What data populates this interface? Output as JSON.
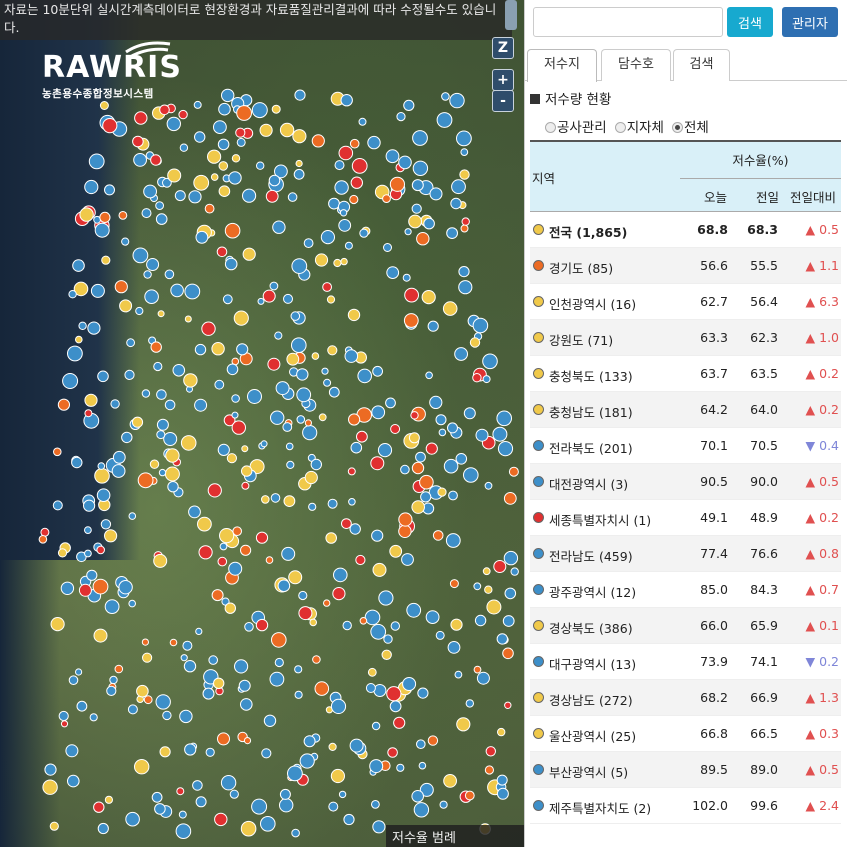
{
  "notice": "자료는 10분단위 실시간계측데이터로 현장환경과 자료품질관리결과에 따라 수정될수도 있습니다.",
  "logo": {
    "brand": "RAWRIS",
    "subtitle": "농촌용수종합정보시스템"
  },
  "map_controls": {
    "z_label": "Z",
    "zoom_in": "+",
    "zoom_out": "-"
  },
  "legend_label": "저수율 범례",
  "search": {
    "placeholder": "",
    "button": "검색",
    "admin": "관리자"
  },
  "tabs": [
    "저수지",
    "담수호",
    "검색"
  ],
  "section_title": "저수량 현황",
  "filters": [
    {
      "label": "공사관리",
      "checked": false
    },
    {
      "label": "지자체",
      "checked": false
    },
    {
      "label": "전체",
      "checked": true
    }
  ],
  "table": {
    "headers": {
      "region": "지역",
      "rate": "저수율(%)",
      "today": "오늘",
      "yesterday": "전일",
      "diff": "전일대비"
    },
    "rows": [
      {
        "name": "전국 (1,865)",
        "today": "68.8",
        "yesterday": "68.3",
        "diff": "▲ 0.5",
        "dot": "#f0c94a",
        "diff_color": "#e05050",
        "bold": true
      },
      {
        "name": "경기도 (85)",
        "today": "56.6",
        "yesterday": "55.5",
        "diff": "▲ 1.1",
        "dot": "#ec6b23",
        "diff_color": "#e05050"
      },
      {
        "name": "인천광역시 (16)",
        "today": "62.7",
        "yesterday": "56.4",
        "diff": "▲ 6.3",
        "dot": "#f0c94a",
        "diff_color": "#e05050"
      },
      {
        "name": "강원도 (71)",
        "today": "63.3",
        "yesterday": "62.3",
        "diff": "▲ 1.0",
        "dot": "#f0c94a",
        "diff_color": "#e05050"
      },
      {
        "name": "충청북도 (133)",
        "today": "63.7",
        "yesterday": "63.5",
        "diff": "▲ 0.2",
        "dot": "#f0c94a",
        "diff_color": "#e05050"
      },
      {
        "name": "충청남도 (181)",
        "today": "64.2",
        "yesterday": "64.0",
        "diff": "▲ 0.2",
        "dot": "#f0c94a",
        "diff_color": "#e05050"
      },
      {
        "name": "전라북도 (201)",
        "today": "70.1",
        "yesterday": "70.5",
        "diff": "▼ 0.4",
        "dot": "#3d8fc9",
        "diff_color": "#7f86d8"
      },
      {
        "name": "대전광역시 (3)",
        "today": "90.5",
        "yesterday": "90.0",
        "diff": "▲ 0.5",
        "dot": "#3d8fc9",
        "diff_color": "#e05050"
      },
      {
        "name": "세종특별자치시 (1)",
        "today": "49.1",
        "yesterday": "48.9",
        "diff": "▲ 0.2",
        "dot": "#e03030",
        "diff_color": "#e05050"
      },
      {
        "name": "전라남도 (459)",
        "today": "77.4",
        "yesterday": "76.6",
        "diff": "▲ 0.8",
        "dot": "#3d8fc9",
        "diff_color": "#e05050"
      },
      {
        "name": "광주광역시 (12)",
        "today": "85.0",
        "yesterday": "84.3",
        "diff": "▲ 0.7",
        "dot": "#3d8fc9",
        "diff_color": "#e05050"
      },
      {
        "name": "경상북도 (386)",
        "today": "66.0",
        "yesterday": "65.9",
        "diff": "▲ 0.1",
        "dot": "#f0c94a",
        "diff_color": "#e05050"
      },
      {
        "name": "대구광역시 (13)",
        "today": "73.9",
        "yesterday": "74.1",
        "diff": "▼ 0.2",
        "dot": "#3d8fc9",
        "diff_color": "#7f86d8"
      },
      {
        "name": "경상남도 (272)",
        "today": "68.2",
        "yesterday": "66.9",
        "diff": "▲ 1.3",
        "dot": "#f0c94a",
        "diff_color": "#e05050"
      },
      {
        "name": "울산광역시 (25)",
        "today": "66.8",
        "yesterday": "66.5",
        "diff": "▲ 0.3",
        "dot": "#f0c94a",
        "diff_color": "#e05050"
      },
      {
        "name": "부산광역시 (5)",
        "today": "89.5",
        "yesterday": "89.0",
        "diff": "▲ 0.5",
        "dot": "#3d8fc9",
        "diff_color": "#e05050"
      },
      {
        "name": "제주특별자치도 (2)",
        "today": "102.0",
        "yesterday": "99.6",
        "diff": "▲ 2.4",
        "dot": "#3d8fc9",
        "diff_color": "#e05050"
      }
    ]
  },
  "colors": {
    "blue_marker": "#3d8fc9",
    "yellow_marker": "#f0c94a",
    "orange_marker": "#ec6b23",
    "red_marker": "#e03030"
  }
}
